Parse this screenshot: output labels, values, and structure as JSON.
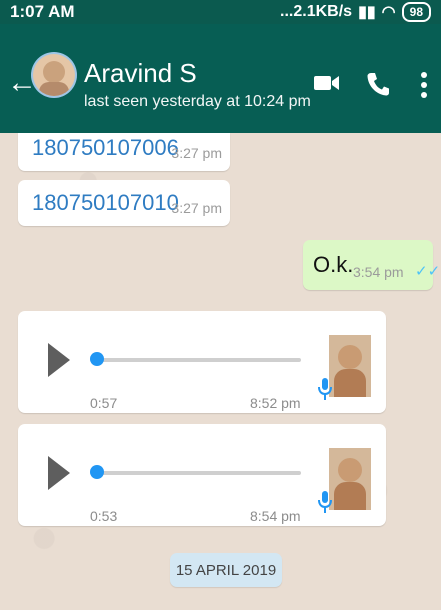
{
  "status_bar": {
    "time": "1:07 AM",
    "network_speed": "...2.1KB/s",
    "battery": "98"
  },
  "header": {
    "contact_name": "Aravind S",
    "last_seen": "last seen yesterday at 10:24 pm",
    "icons": [
      "back-arrow-icon",
      "video-call-icon",
      "phone-icon",
      "more-vert-icon"
    ]
  },
  "messages": [
    {
      "type": "incoming",
      "text": "180750107006",
      "time": "3:27 pm"
    },
    {
      "type": "incoming",
      "text": "180750107010",
      "time": "3:27 pm"
    },
    {
      "type": "outgoing",
      "text": "O.k.",
      "time": "3:54 pm",
      "status": "read"
    }
  ],
  "voice_messages": [
    {
      "duration": "0:57",
      "time": "8:52 pm",
      "progress": 0
    },
    {
      "duration": "0:53",
      "time": "8:54 pm",
      "progress": 0
    }
  ],
  "date_badge": "15 APRIL 2019",
  "colors": {
    "header": "#075e54",
    "incoming_bubble": "#ffffff",
    "outgoing_bubble": "#dcf8c6",
    "link_text": "#2f7cc2",
    "read_ticks": "#4fc3f7",
    "voice_knob": "#2196f3"
  }
}
